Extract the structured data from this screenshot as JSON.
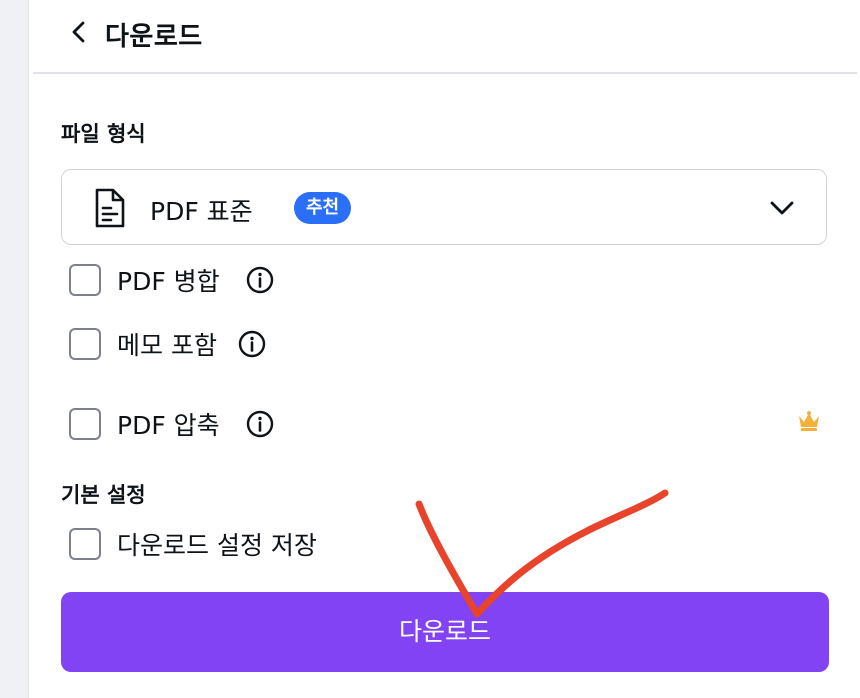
{
  "header": {
    "title": "다운로드",
    "back_icon": "chevron-left-icon"
  },
  "file_format": {
    "section_label": "파일 형식",
    "selected": "PDF 표준",
    "badge": "추천",
    "badge_color": "#2b6ef7",
    "doc_icon": "document-icon",
    "dropdown_icon": "chevron-down-icon"
  },
  "options": [
    {
      "label": "PDF 병합",
      "checked": false,
      "info_icon": "info-icon"
    },
    {
      "label": "메모 포함",
      "checked": false,
      "info_icon": "info-icon"
    },
    {
      "label": "PDF 압축",
      "checked": false,
      "info_icon": "info-icon",
      "premium_icon": "crown-icon"
    }
  ],
  "basic_settings": {
    "section_label": "기본 설정",
    "save_settings": {
      "label": "다운로드 설정 저장",
      "checked": false
    }
  },
  "download_button": {
    "label": "다운로드",
    "color": "#8243f5"
  },
  "annotation": {
    "type": "checkmark",
    "color": "#e8432b"
  }
}
